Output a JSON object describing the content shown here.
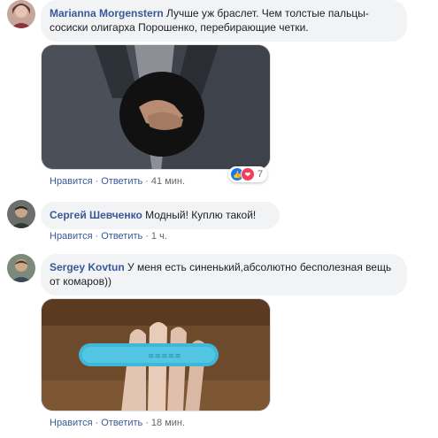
{
  "comments": [
    {
      "author": "Marianna Morgenstern",
      "text": " Лучше уж браслет. Чем толстые пальцы-сосиски олигарха Порошенко, перебирающие четки.",
      "actions": {
        "like": "Нравится",
        "reply": "Ответить",
        "time": "41 мин."
      },
      "reactions_count": "7"
    },
    {
      "author": "Сергей Шевченко",
      "text": " Модный! Куплю такой!",
      "actions": {
        "like": "Нравится",
        "reply": "Ответить",
        "time": "1 ч."
      }
    },
    {
      "author": "Sergey Kovtun",
      "text": " У меня есть синенький,абсолютно бесполезная вещь от комаров))",
      "actions": {
        "like": "Нравится",
        "reply": "Ответить",
        "time": "18 мин."
      }
    }
  ],
  "separator": "·",
  "colors": {
    "link": "#385898",
    "bubble": "#f2f3f5",
    "meta": "#606770",
    "like": "#1877f2",
    "love": "#f33e58",
    "band": "#3fb8d8"
  },
  "icons": [
    "like-reaction-icon",
    "love-reaction-icon"
  ]
}
